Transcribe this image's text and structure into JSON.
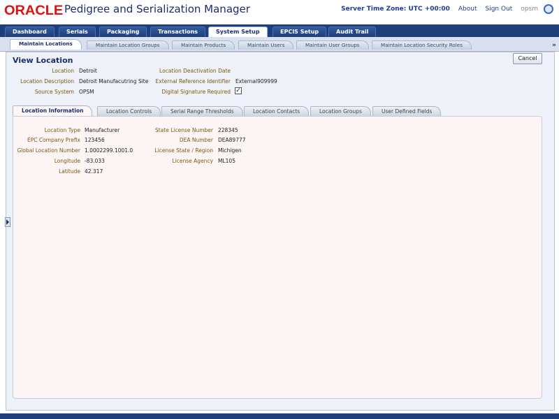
{
  "header": {
    "logo": "ORACLE",
    "title": "Pedigree and Serialization Manager",
    "server_tz": "Server Time Zone: UTC +00:00",
    "about": "About",
    "sign_out": "Sign Out",
    "user": "opsm"
  },
  "global_tabs": [
    {
      "label": "Dashboard"
    },
    {
      "label": "Serials"
    },
    {
      "label": "Packaging"
    },
    {
      "label": "Transactions"
    },
    {
      "label": "System Setup"
    },
    {
      "label": "EPCIS Setup"
    },
    {
      "label": "Audit Trail"
    }
  ],
  "sub_tabs": [
    {
      "label": "Maintain Locations"
    },
    {
      "label": "Maintain Location Groups"
    },
    {
      "label": "Maintain Products"
    },
    {
      "label": "Maintain Users"
    },
    {
      "label": "Maintain User Groups"
    },
    {
      "label": "Maintain Location Security Roles"
    }
  ],
  "sub_tabs_more": "»",
  "page": {
    "title": "View Location",
    "cancel": "Cancel"
  },
  "summary": {
    "location_label": "Location",
    "location_value": "Detroit",
    "description_label": "Location Description",
    "description_value": "Detroit Manufacutring Site",
    "source_label": "Source System",
    "source_value": "OPSM",
    "deactivation_label": "Location Deactivation Date",
    "deactivation_value": "",
    "extref_label": "External Reference Identifier",
    "extref_value": "External909999",
    "digsig_label": "Digital Signature Required",
    "digsig_checked": "✓"
  },
  "detail_tabs": [
    {
      "label": "Location Information"
    },
    {
      "label": "Location Controls"
    },
    {
      "label": "Serial Range Thresholds"
    },
    {
      "label": "Location Contacts"
    },
    {
      "label": "Location Groups"
    },
    {
      "label": "User Defined Fields"
    }
  ],
  "location_info": {
    "left": [
      {
        "label": "Location Type",
        "value": "Manufacturer"
      },
      {
        "label": "EPC Company Prefix",
        "value": "123456"
      },
      {
        "label": "Global Location Number",
        "value": "1.0002299.1001.0"
      },
      {
        "label": "Longitude",
        "value": "-83.033"
      },
      {
        "label": "Latitude",
        "value": "42.317"
      }
    ],
    "right": [
      {
        "label": "State License Number",
        "value": "228345"
      },
      {
        "label": "DEA Number",
        "value": "DEA89777"
      },
      {
        "label": "License State / Region",
        "value": "Michigen"
      },
      {
        "label": "License Agency",
        "value": "ML105"
      }
    ]
  }
}
